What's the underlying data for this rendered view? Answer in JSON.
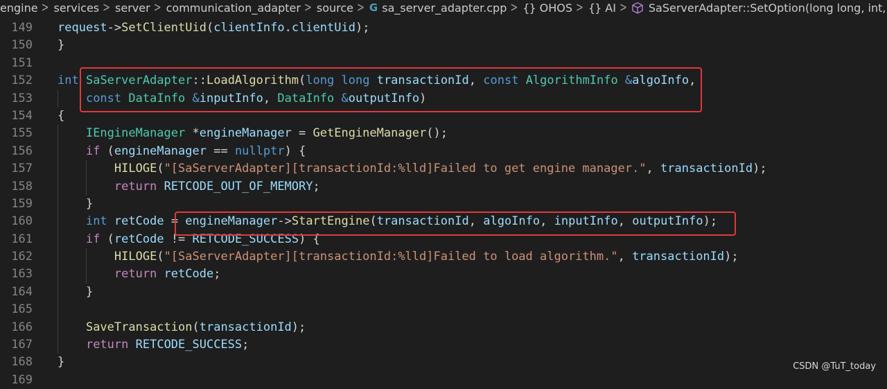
{
  "breadcrumb": {
    "items": [
      "engine",
      "services",
      "server",
      "communication_adapter",
      "source",
      "sa_server_adapter.cpp",
      "OHOS",
      "AI",
      "SaServerAdapter::SetOption(long long, int, cons"
    ],
    "file_icon": "cpp-file-icon",
    "namespace_icon": "braces-icon",
    "method_icon": "cube-icon"
  },
  "lines": [
    {
      "num": "149",
      "tokens": [
        [
          "var",
          "request"
        ],
        [
          "plain",
          "->"
        ],
        [
          "fn",
          "SetClientUid"
        ],
        [
          "plain",
          "("
        ],
        [
          "var",
          "clientInfo"
        ],
        [
          "plain",
          "."
        ],
        [
          "var",
          "clientUid"
        ],
        [
          "plain",
          ");"
        ]
      ]
    },
    {
      "num": "150",
      "tokens": [
        [
          "plain",
          "}"
        ]
      ]
    },
    {
      "num": "151",
      "tokens": []
    },
    {
      "num": "152",
      "tokens": [
        [
          "kw",
          "int"
        ],
        [
          "plain",
          " "
        ],
        [
          "ty",
          "SaServerAdapter"
        ],
        [
          "plain",
          "::"
        ],
        [
          "fn",
          "LoadAlgorithm"
        ],
        [
          "plain",
          "("
        ],
        [
          "kw",
          "long"
        ],
        [
          "plain",
          " "
        ],
        [
          "kw",
          "long"
        ],
        [
          "plain",
          " "
        ],
        [
          "var",
          "transactionId"
        ],
        [
          "plain",
          ", "
        ],
        [
          "kw",
          "const"
        ],
        [
          "plain",
          " "
        ],
        [
          "ty",
          "AlgorithmInfo"
        ],
        [
          "plain",
          " "
        ],
        [
          "kw",
          "&"
        ],
        [
          "var",
          "algoInfo"
        ],
        [
          "plain",
          ","
        ]
      ]
    },
    {
      "num": "153",
      "tokens": [
        [
          "plain",
          "    "
        ],
        [
          "kw",
          "const"
        ],
        [
          "plain",
          " "
        ],
        [
          "ty",
          "DataInfo"
        ],
        [
          "plain",
          " "
        ],
        [
          "kw",
          "&"
        ],
        [
          "var",
          "inputInfo"
        ],
        [
          "plain",
          ", "
        ],
        [
          "ty",
          "DataInfo"
        ],
        [
          "plain",
          " "
        ],
        [
          "kw",
          "&"
        ],
        [
          "var",
          "outputInfo"
        ],
        [
          "plain",
          ")"
        ]
      ]
    },
    {
      "num": "154",
      "tokens": [
        [
          "plain",
          "{"
        ]
      ]
    },
    {
      "num": "155",
      "tokens": [
        [
          "plain",
          "    "
        ],
        [
          "ty",
          "IEngineManager"
        ],
        [
          "plain",
          " *"
        ],
        [
          "var",
          "engineManager"
        ],
        [
          "plain",
          " = "
        ],
        [
          "fn",
          "GetEngineManager"
        ],
        [
          "plain",
          "();"
        ]
      ]
    },
    {
      "num": "156",
      "tokens": [
        [
          "plain",
          "    "
        ],
        [
          "ctl",
          "if"
        ],
        [
          "plain",
          " ("
        ],
        [
          "var",
          "engineManager"
        ],
        [
          "plain",
          " == "
        ],
        [
          "kw",
          "nullptr"
        ],
        [
          "plain",
          ") {"
        ]
      ]
    },
    {
      "num": "157",
      "tokens": [
        [
          "plain",
          "        "
        ],
        [
          "mac",
          "HILOGE"
        ],
        [
          "plain",
          "("
        ],
        [
          "str",
          "\"[SaServerAdapter][transactionId:%lld]Failed to get engine manager.\""
        ],
        [
          "plain",
          ", "
        ],
        [
          "var",
          "transactionId"
        ],
        [
          "plain",
          ");"
        ]
      ]
    },
    {
      "num": "158",
      "tokens": [
        [
          "plain",
          "        "
        ],
        [
          "ctl",
          "return"
        ],
        [
          "plain",
          " "
        ],
        [
          "var",
          "RETCODE_OUT_OF_MEMORY"
        ],
        [
          "plain",
          ";"
        ]
      ]
    },
    {
      "num": "159",
      "tokens": [
        [
          "plain",
          "    }"
        ]
      ]
    },
    {
      "num": "160",
      "tokens": [
        [
          "plain",
          "    "
        ],
        [
          "kw",
          "int"
        ],
        [
          "plain",
          " "
        ],
        [
          "var",
          "retCode"
        ],
        [
          "plain",
          " = "
        ],
        [
          "var",
          "engineManager"
        ],
        [
          "plain",
          "->"
        ],
        [
          "fn",
          "StartEngine"
        ],
        [
          "plain",
          "("
        ],
        [
          "var",
          "transactionId"
        ],
        [
          "plain",
          ", "
        ],
        [
          "var",
          "algoInfo"
        ],
        [
          "plain",
          ", "
        ],
        [
          "var",
          "inputInfo"
        ],
        [
          "plain",
          ", "
        ],
        [
          "var",
          "outputInfo"
        ],
        [
          "plain",
          ");"
        ]
      ]
    },
    {
      "num": "161",
      "tokens": [
        [
          "plain",
          "    "
        ],
        [
          "ctl",
          "if"
        ],
        [
          "plain",
          " ("
        ],
        [
          "var",
          "retCode"
        ],
        [
          "plain",
          " != "
        ],
        [
          "var",
          "RETCODE_SUCCESS"
        ],
        [
          "plain",
          ") {"
        ]
      ]
    },
    {
      "num": "162",
      "tokens": [
        [
          "plain",
          "        "
        ],
        [
          "mac",
          "HILOGE"
        ],
        [
          "plain",
          "("
        ],
        [
          "str",
          "\"[SaServerAdapter][transactionId:%lld]Failed to load algorithm.\""
        ],
        [
          "plain",
          ", "
        ],
        [
          "var",
          "transactionId"
        ],
        [
          "plain",
          ");"
        ]
      ]
    },
    {
      "num": "163",
      "tokens": [
        [
          "plain",
          "        "
        ],
        [
          "ctl",
          "return"
        ],
        [
          "plain",
          " "
        ],
        [
          "var",
          "retCode"
        ],
        [
          "plain",
          ";"
        ]
      ]
    },
    {
      "num": "164",
      "tokens": [
        [
          "plain",
          "    }"
        ]
      ]
    },
    {
      "num": "165",
      "tokens": []
    },
    {
      "num": "166",
      "tokens": [
        [
          "plain",
          "    "
        ],
        [
          "fn",
          "SaveTransaction"
        ],
        [
          "plain",
          "("
        ],
        [
          "var",
          "transactionId"
        ],
        [
          "plain",
          ");"
        ]
      ]
    },
    {
      "num": "167",
      "tokens": [
        [
          "plain",
          "    "
        ],
        [
          "ctl",
          "return"
        ],
        [
          "plain",
          " "
        ],
        [
          "var",
          "RETCODE_SUCCESS"
        ],
        [
          "plain",
          ";"
        ]
      ]
    },
    {
      "num": "168",
      "tokens": [
        [
          "plain",
          "}"
        ]
      ]
    },
    {
      "num": "169",
      "tokens": []
    }
  ],
  "highlight_color": "#e0393e",
  "watermark": "CSDN @TuT_today"
}
